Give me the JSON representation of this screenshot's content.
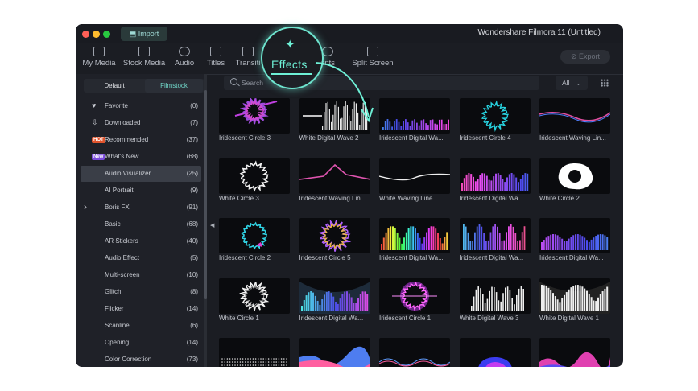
{
  "window": {
    "title": "Wondershare Filmora 11 (Untitled)",
    "import_label": "Import",
    "export_label": "Export"
  },
  "tabs": [
    {
      "label": "My Media",
      "icon": "folder-icon"
    },
    {
      "label": "Stock Media",
      "icon": "cloud-icon"
    },
    {
      "label": "Audio",
      "icon": "music-icon"
    },
    {
      "label": "Titles",
      "icon": "text-icon"
    },
    {
      "label": "Transiti",
      "icon": "transition-icon"
    },
    {
      "label": "Effects",
      "icon": "sparkle-icon"
    },
    {
      "label": "ents",
      "icon": "elements-icon"
    },
    {
      "label": "Split Screen",
      "icon": "split-icon"
    }
  ],
  "sidebar": {
    "segments": [
      "Default",
      "Filmstock"
    ],
    "categories": [
      {
        "label": "Favorite",
        "count": "(0)",
        "icon": "heart-icon"
      },
      {
        "label": "Downloaded",
        "count": "(7)",
        "icon": "download-icon"
      },
      {
        "label": "Recommended",
        "count": "(37)",
        "badge": "HOT"
      },
      {
        "label": "What's New",
        "count": "(68)",
        "badge": "New"
      },
      {
        "label": "Audio Visualizer",
        "count": "(25)",
        "selected": true
      },
      {
        "label": "AI Portrait",
        "count": "(9)"
      },
      {
        "label": "Boris FX",
        "count": "(91)",
        "icon": "chevron-right-icon"
      },
      {
        "label": "Basic",
        "count": "(68)"
      },
      {
        "label": "AR Stickers",
        "count": "(40)"
      },
      {
        "label": "Audio Effect",
        "count": "(5)"
      },
      {
        "label": "Multi-screen",
        "count": "(10)"
      },
      {
        "label": "Glitch",
        "count": "(8)"
      },
      {
        "label": "Flicker",
        "count": "(14)"
      },
      {
        "label": "Scanline",
        "count": "(6)"
      },
      {
        "label": "Opening",
        "count": "(14)"
      },
      {
        "label": "Color Correction",
        "count": "(73)"
      }
    ]
  },
  "search": {
    "placeholder": "Search",
    "filter": "All"
  },
  "effects": [
    {
      "label": "Iridescent Circle 3",
      "style": "iri-circle"
    },
    {
      "label": "White  Digital Wave 2",
      "style": "white-bars"
    },
    {
      "label": "Iridescent Digital Wa...",
      "style": "iri-eq"
    },
    {
      "label": "Iridescent Circle 4",
      "style": "cyan-ring"
    },
    {
      "label": "Iridescent Waving Lin...",
      "style": "iri-line"
    },
    {
      "label": "White Circle 3",
      "style": "white-ring"
    },
    {
      "label": "Iridescent Waving Lin...",
      "style": "iri-peak"
    },
    {
      "label": "White Waving Line",
      "style": "white-line"
    },
    {
      "label": "Iridescent Digital Wa...",
      "style": "pink-eq"
    },
    {
      "label": "White Circle 2",
      "style": "white-blob"
    },
    {
      "label": "Iridescent Circle 2",
      "style": "cyan-ring2"
    },
    {
      "label": "Iridescent Circle 5",
      "style": "purple-blob"
    },
    {
      "label": "Iridescent Digital Wa...",
      "style": "rainbow-eq"
    },
    {
      "label": "Iridescent Digital Wa...",
      "style": "rainbow-wave"
    },
    {
      "label": "Iridescent Digital Wa...",
      "style": "pink-eq2"
    },
    {
      "label": "White Circle 1",
      "style": "white-ring2"
    },
    {
      "label": "Iridescent Digital Wa...",
      "style": "cyan-bars"
    },
    {
      "label": "Iridescent Circle 1",
      "style": "glow-ring"
    },
    {
      "label": "White Digital Wave 3",
      "style": "white-eq"
    },
    {
      "label": "White Digital Wave 1",
      "style": "white-arc"
    },
    {
      "label": "",
      "style": "dots"
    },
    {
      "label": "",
      "style": "blue-mountain"
    },
    {
      "label": "",
      "style": "thin-wave"
    },
    {
      "label": "",
      "style": "blue-blob"
    },
    {
      "label": "",
      "style": "pink-mountain"
    }
  ],
  "colors": {
    "accent": "#6ef0d6",
    "window_bg": "#1b1d23",
    "traffic": [
      "#ff5f57",
      "#febc2e",
      "#28c840"
    ]
  }
}
